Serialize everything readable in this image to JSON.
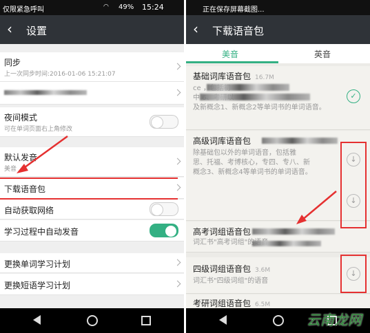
{
  "left_screen": {
    "status": {
      "carrier": "仅限紧急呼叫",
      "battery": "49%",
      "time": "15:24"
    },
    "header": {
      "back_icon": "‹",
      "title": "设置"
    },
    "settings": [
      {
        "title": "同步",
        "subtitle": "上一次同步时间:2016-01-06 15:21:07"
      },
      {
        "title": "",
        "subtitle": ""
      },
      {
        "title": "夜间模式",
        "subtitle": "可在单词页面右上角修改",
        "toggle": false
      },
      {
        "title": "默认发音",
        "subtitle": "美音"
      },
      {
        "title": "下载语音包"
      },
      {
        "title": "自动获取网络",
        "toggle": false
      },
      {
        "title": "学习过程中自动发音",
        "toggle": true
      },
      {
        "title": "更换单词学习计划"
      },
      {
        "title": "更换短语学习计划"
      }
    ]
  },
  "right_screen": {
    "status": {
      "notice": "正在保存屏幕截图..."
    },
    "header": {
      "back_icon": "‹",
      "title": "下载语音包"
    },
    "tabs": [
      "美音",
      "英音"
    ],
    "packs": [
      {
        "title": "基础词库语音包",
        "size": "16.7M",
        "desc_line1": "ce                                 ，包括初",
        "desc_line2": "中                                6、考研以",
        "desc_line3": "及新概念1、新概念2等单词书的单词语音。",
        "status": "downloaded"
      },
      {
        "title": "高级词库语音包",
        "size": "",
        "desc_line1": "除基础包以外的单词语音，包括雅",
        "desc_line2": "思、托福、考博核心，专四、专八、新",
        "desc_line3": "概念3、新概念4等单词书的单词语音。",
        "status": "download"
      },
      {
        "title": "高考词组语音包",
        "size": "",
        "desc_line1": "词汇书\"高考词组\"的语音",
        "status": "download"
      },
      {
        "title": "四级词组语音包",
        "size": "3.6M",
        "desc_line1": "词汇书\"四级词组\"的语音",
        "status": "download"
      },
      {
        "title": "考研词组语音包",
        "size": "6.5M",
        "desc_line1": "",
        "status": "download"
      }
    ],
    "watermark": "云南龙网"
  },
  "colors": {
    "accent": "#33b083",
    "appbar": "#2f3338",
    "annotation": "#e53030"
  },
  "icons": {
    "download": "download-circle-icon",
    "done": "check-circle-icon",
    "chevron": "chevron-right-icon"
  }
}
